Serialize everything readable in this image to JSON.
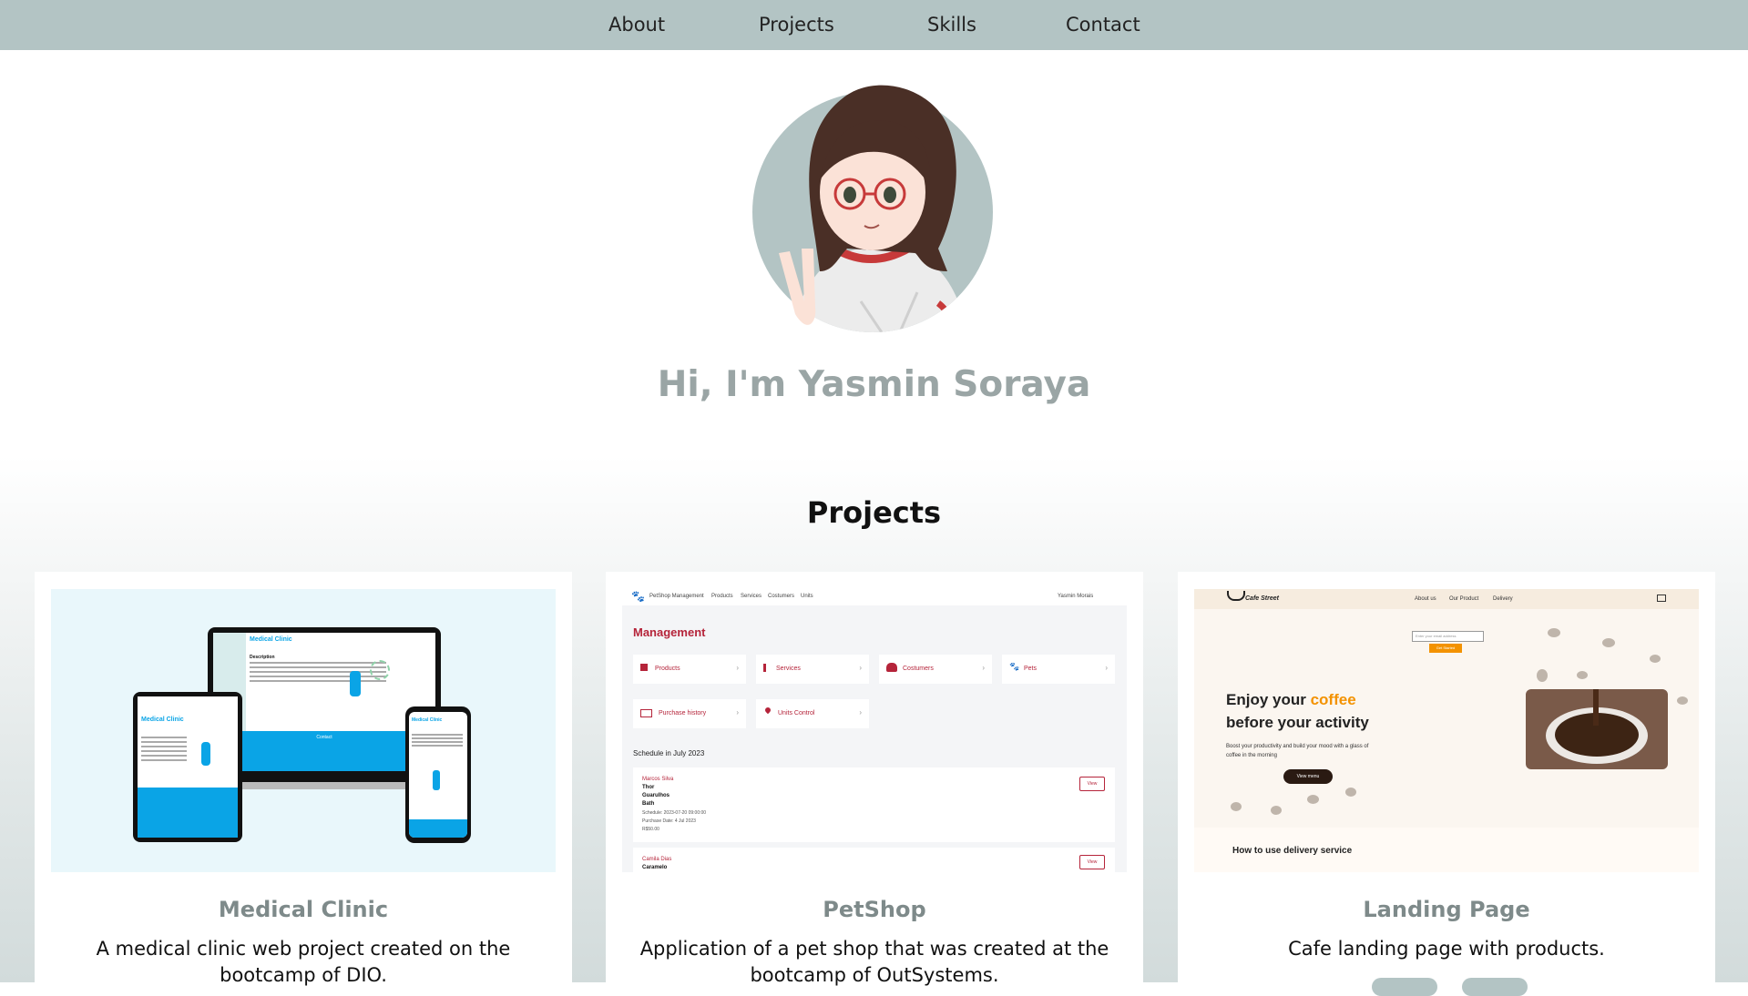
{
  "nav": {
    "about": "About",
    "projects": "Projects",
    "skills": "Skills",
    "contact": "Contact"
  },
  "hero": {
    "avatar_icon": "girl-with-glasses-illustration",
    "title": "Hi, I'm Yasmin Soraya"
  },
  "projects": {
    "title": "Projects",
    "cards": [
      {
        "title": "Medical Clinic",
        "description": "A medical clinic web project created on the bootcamp of DIO.",
        "thumb": {
          "brand": "Medical Clinic",
          "desc_heading": "Description",
          "footer": "Contact"
        }
      },
      {
        "title": "PetShop",
        "description": "Application of a pet shop that was created at the bootcamp of OutSystems.",
        "thumb": {
          "nav_items": [
            "PetShop Management",
            "Products",
            "Services",
            "Costumers",
            "Units"
          ],
          "user": "Yasmin Morais",
          "heading": "Management",
          "tiles": [
            "Products",
            "Services",
            "Costumers",
            "Pets",
            "Purchase history",
            "Units Control"
          ],
          "schedule_title": "Schedule in July 2023",
          "entries": [
            {
              "name": "Marcos Silva",
              "pet": "Thor",
              "lines": [
                "Guarulhos",
                "Bath",
                "Schedule: 2023-07-20 09:00:00",
                "Purchase Date: 4 Jul 2023",
                "R$50.00"
              ],
              "action": "View"
            },
            {
              "name": "Camila Dias",
              "pet": "Caramelo",
              "lines": [],
              "action": "View"
            }
          ]
        }
      },
      {
        "title": "Landing Page",
        "description": "Cafe landing page with products.",
        "thumb": {
          "logo": "Cafe Street",
          "nav_items": [
            "About us",
            "Our Product",
            "Delivery"
          ],
          "email_placeholder": "Enter your email address",
          "cta": "Get Started",
          "headline_a": "Enjoy your ",
          "headline_accent": "coffee",
          "headline_b": "before your activity",
          "sub": "Boost your productivity and build your mood with a glass of coffee in the morning",
          "menu_button": "View menu",
          "section": "How to use delivery service"
        }
      }
    ]
  },
  "colors": {
    "nav_bg": "#b3c4c4",
    "hero_title": "#9aa5a5",
    "card_title": "#7e8a8a",
    "petshop_accent": "#b5243a",
    "cafe_accent": "#f39200",
    "clinic_blue": "#0aa4e6"
  }
}
